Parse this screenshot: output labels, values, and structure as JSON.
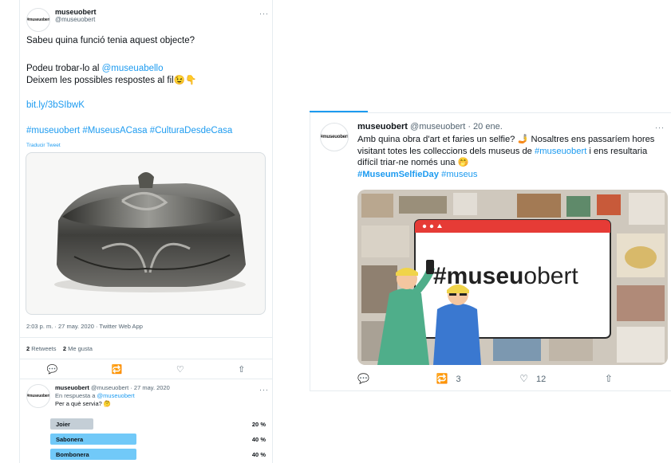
{
  "left_tweet": {
    "avatar_text": "#museuobert",
    "name": "museuobert",
    "handle": "@museuobert",
    "more": "···",
    "line1": "Sabeu quina funció tenia aquest objecte?",
    "line2_prefix": "Podeu trobar-lo al ",
    "line2_mention": "@museuabello",
    "line3": "Deixem les possibles respostes al fil",
    "emoji1": "😉👇",
    "link": "bit.ly/3bSIbwK",
    "hashtags": "#museuobert #MuseusACasa #CulturaDesdeCasa",
    "translate": "Traducir Tweet",
    "meta": "2:03 p. m. · 27 may. 2020 · Twitter Web App",
    "retweets_count": "2",
    "retweets_label": " Retweets",
    "likes_count": "2",
    "likes_label": " Me gusta",
    "actions": [
      "💬",
      "🔁",
      "♡",
      "⇧"
    ]
  },
  "reply": {
    "avatar_text": "#museuobert",
    "name": "museuobert",
    "handle_date": " @museuobert · 27 may. 2020",
    "more": "···",
    "reply_to_prefix": "En respuesta a ",
    "reply_to_mention": "@museuobert",
    "question": "Per a què servia? 🤔",
    "poll": [
      {
        "label": "Joier",
        "percent": "20 %",
        "value": 0.2,
        "color": "#c4ced6"
      },
      {
        "label": "Sabonera",
        "percent": "40 %",
        "value": 0.4,
        "color": "#71c9f8"
      },
      {
        "label": "Bombonera",
        "percent": "40 %",
        "value": 0.4,
        "color": "#71c9f8"
      }
    ]
  },
  "right_tweet": {
    "avatar_text": "#museuobert",
    "name": "museuobert",
    "handle_date": " @museuobert · 20 ene.",
    "more": "···",
    "text_a": "Amb quina obra d'art et faries un selfie? 🤳 Nosaltres ens passaríem hores visitant totes les colleccions dels museus de ",
    "text_mention": "#museuobert",
    "text_b": " i ens resultaria difícil triar-ne només una 🤭",
    "tags_bold": "#MuseumSelfieDay",
    "tags_rest": " #museus",
    "image_logo_bold": "#museu",
    "image_logo_light": "obert",
    "replies": "",
    "retweets": "3",
    "likes": "12",
    "icons": [
      "💬",
      "🔁",
      "♡",
      "⇧"
    ]
  }
}
